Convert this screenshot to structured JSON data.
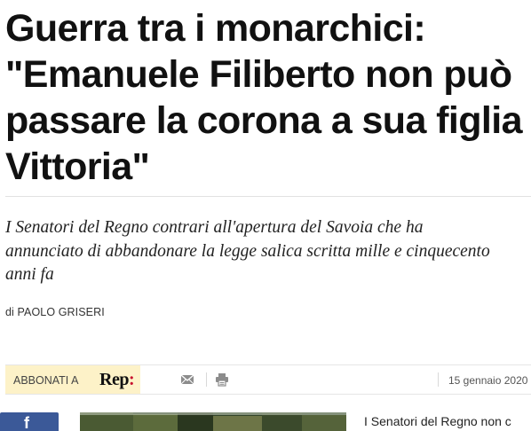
{
  "article": {
    "headline": "Guerra tra i monarchici:\n\"Emanuele Filiberto non può\npassare la corona a sua figlia\nVittoria\"",
    "standfirst": "I Senatori del Regno contrari all'apertura del Savoia che ha\nannunciato di abbandonare la legge salica scritta mille e cinquecento\nanni fa",
    "byline": "di PAOLO GRISERI",
    "body_start": "I Senatori del Regno non c"
  },
  "toolbar": {
    "subscribe_label": "ABBONATI A",
    "logo_text": "Rep",
    "logo_suffix": ":",
    "date": "15 gennaio 2020",
    "icons": [
      "mail-icon",
      "print-icon"
    ]
  },
  "social": {
    "facebook_glyph": "f"
  },
  "colors": {
    "subscribe_bg": "#fdf2c8",
    "facebook": "#3b5998",
    "rep_accent": "#c8102e"
  }
}
